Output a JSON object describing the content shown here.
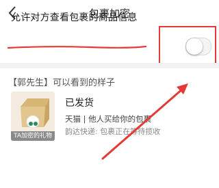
{
  "header": {
    "title": "包裹加密"
  },
  "setting": {
    "label": "允许对方查看包裹的商品信息",
    "enabled": false
  },
  "preview": {
    "title": "【郭先生】可以看到的样子",
    "package": {
      "thumb_caption": "TA加密的礼物",
      "status": "已发货",
      "source": "天猫 | 他人买给你的包裹",
      "express": "韵达快递: 包裹正在等待揽收"
    }
  },
  "colors": {
    "annotation": "#e53935",
    "toggle_off": "#f4f4f4"
  }
}
